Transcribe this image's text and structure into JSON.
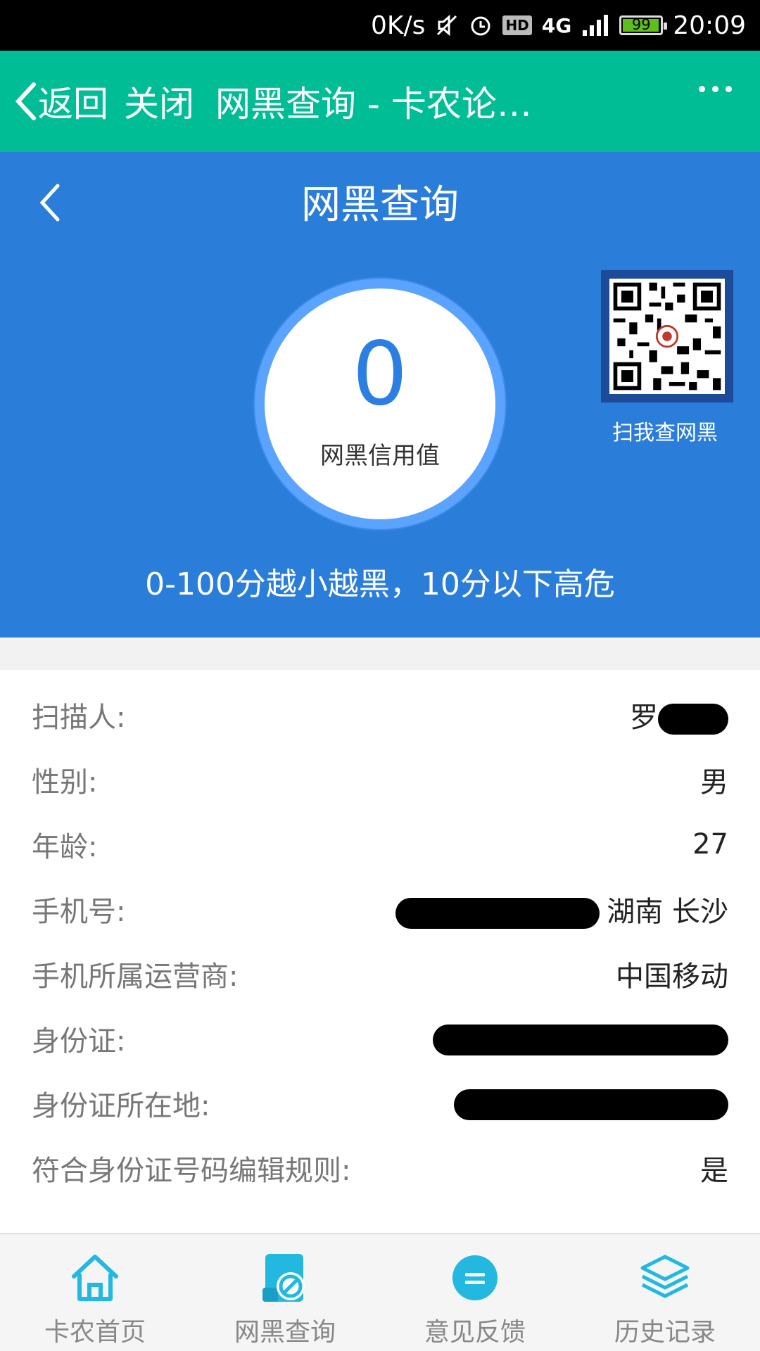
{
  "status_bar": {
    "speed": "0K/s",
    "hd": "HD",
    "network": "4G",
    "battery": "99",
    "battery_fraction": 0.99,
    "time": "20:09"
  },
  "nav": {
    "back_label": "返回",
    "close_label": "关闭",
    "title": "网黑查询 - 卡农论…"
  },
  "header": {
    "title": "网黑查询",
    "score": "0",
    "score_label": "网黑信用值",
    "qr_label": "扫我查网黑",
    "tip": "0-100分越小越黑，10分以下高危"
  },
  "info": {
    "rows": [
      {
        "label": "扫描人:",
        "value": "罗"
      },
      {
        "label": "性别:",
        "value": "男"
      },
      {
        "label": "年龄:",
        "value": "27"
      },
      {
        "label": "手机号:",
        "value": "湖南 长沙"
      },
      {
        "label": "手机所属运营商:",
        "value": "中国移动"
      },
      {
        "label": "身份证:",
        "value": ""
      },
      {
        "label": "身份证所在地:",
        "value": ""
      },
      {
        "label": "符合身份证号码编辑规则:",
        "value": "是"
      }
    ]
  },
  "tabs": [
    {
      "label": "卡农首页",
      "icon": "home-icon"
    },
    {
      "label": "网黑查询",
      "icon": "query-icon"
    },
    {
      "label": "意见反馈",
      "icon": "feedback-icon"
    },
    {
      "label": "历史记录",
      "icon": "layers-icon"
    }
  ],
  "colors": {
    "nav_bg": "#00bd96",
    "header_bg": "#2a7dd9",
    "score_color": "#2b7fe3",
    "tab_icon": "#22b8e0"
  }
}
